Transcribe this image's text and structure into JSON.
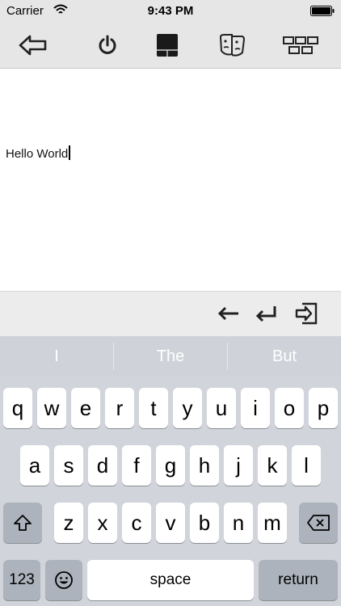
{
  "status_bar": {
    "carrier": "Carrier",
    "time": "9:43 PM"
  },
  "toolbar": {
    "buttons": [
      {
        "icon": "back-arrow-icon"
      },
      {
        "icon": "power-icon"
      },
      {
        "icon": "touchpad-icon"
      },
      {
        "icon": "faces-icon"
      },
      {
        "icon": "grid-keys-icon"
      }
    ]
  },
  "editor": {
    "text": "Hello World"
  },
  "accessory": {
    "buttons": [
      {
        "icon": "left-arrow-icon"
      },
      {
        "icon": "return-arrow-icon"
      },
      {
        "icon": "send-icon"
      }
    ]
  },
  "suggestions": [
    "I",
    "The",
    "But"
  ],
  "keyboard": {
    "row1": [
      "q",
      "w",
      "e",
      "r",
      "t",
      "y",
      "u",
      "i",
      "o",
      "p"
    ],
    "row2": [
      "a",
      "s",
      "d",
      "f",
      "g",
      "h",
      "j",
      "k",
      "l"
    ],
    "row3": [
      "z",
      "x",
      "c",
      "v",
      "b",
      "n",
      "m"
    ],
    "numbers_label": "123",
    "space_label": "space",
    "return_label": "return"
  }
}
